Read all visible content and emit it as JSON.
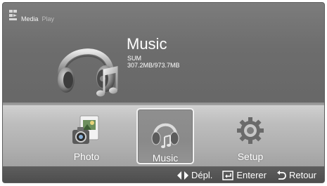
{
  "app": {
    "brand_main": "Media",
    "brand_sub": "Play"
  },
  "current": {
    "title": "Music",
    "device": "SUM",
    "storage": "307.2MB/973.7MB"
  },
  "menu": [
    {
      "label": "Photo",
      "icon": "photo-icon",
      "selected": false
    },
    {
      "label": "Music",
      "icon": "headphones-icon",
      "selected": true
    },
    {
      "label": "Setup",
      "icon": "gear-icon",
      "selected": false
    }
  ],
  "hints": [
    {
      "icon": "left-right-arrows-icon",
      "label": "Dépl."
    },
    {
      "icon": "enter-icon",
      "label": "Enterer"
    },
    {
      "icon": "return-icon",
      "label": "Retour"
    }
  ],
  "colors": {
    "panel": "#6d6d6d",
    "menu_band": "#bdbdbd",
    "hint_bar": "#505050",
    "text": "#ffffff"
  }
}
